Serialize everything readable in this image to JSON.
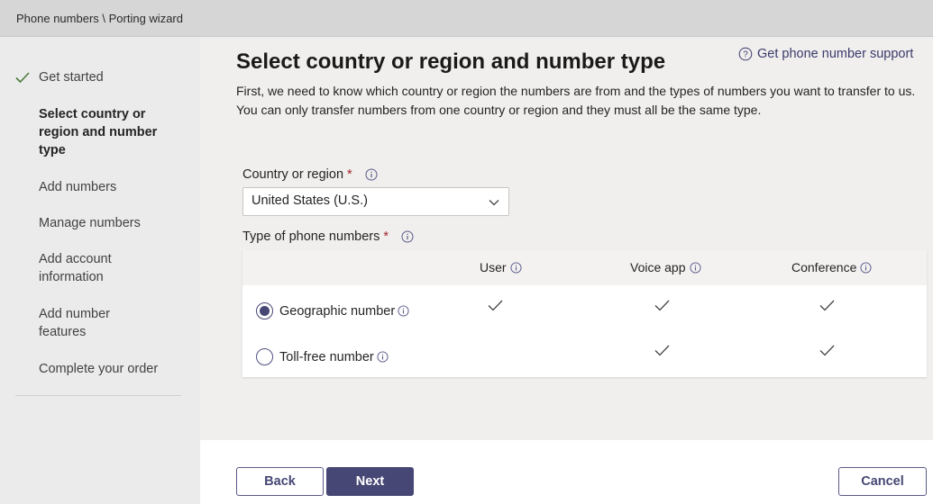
{
  "breadcrumb": "Phone numbers \\ Porting wizard",
  "steps": [
    {
      "label": "Get started"
    },
    {
      "label": "Select country or region and number type"
    },
    {
      "label": "Add numbers"
    },
    {
      "label": "Manage numbers"
    },
    {
      "label": "Add account information"
    },
    {
      "label": "Add number features"
    },
    {
      "label": "Complete your order"
    }
  ],
  "main": {
    "title": "Select country or region and number type",
    "support_link": "Get phone number support",
    "description": "First, we need to know which country or region the numbers are from and the types of numbers you want to transfer to us. You can only transfer numbers from one country or region and they must all be the same type.",
    "country_label": "Country or region",
    "required_mark": "*",
    "country_value": "United States (U.S.)",
    "type_label": "Type of phone numbers",
    "columns": [
      {
        "label": "User"
      },
      {
        "label": "Voice app"
      },
      {
        "label": "Conference"
      }
    ],
    "rows": [
      {
        "label": "Geographic number",
        "selected": true,
        "user": true,
        "voice_app": true,
        "conference": true
      },
      {
        "label": "Toll-free number",
        "selected": false,
        "user": false,
        "voice_app": true,
        "conference": true
      }
    ]
  },
  "footer": {
    "back_label": "Back",
    "next_label": "Next",
    "cancel_label": "Cancel"
  },
  "colors": {
    "accent": "#464775",
    "required": "#a4262c"
  }
}
